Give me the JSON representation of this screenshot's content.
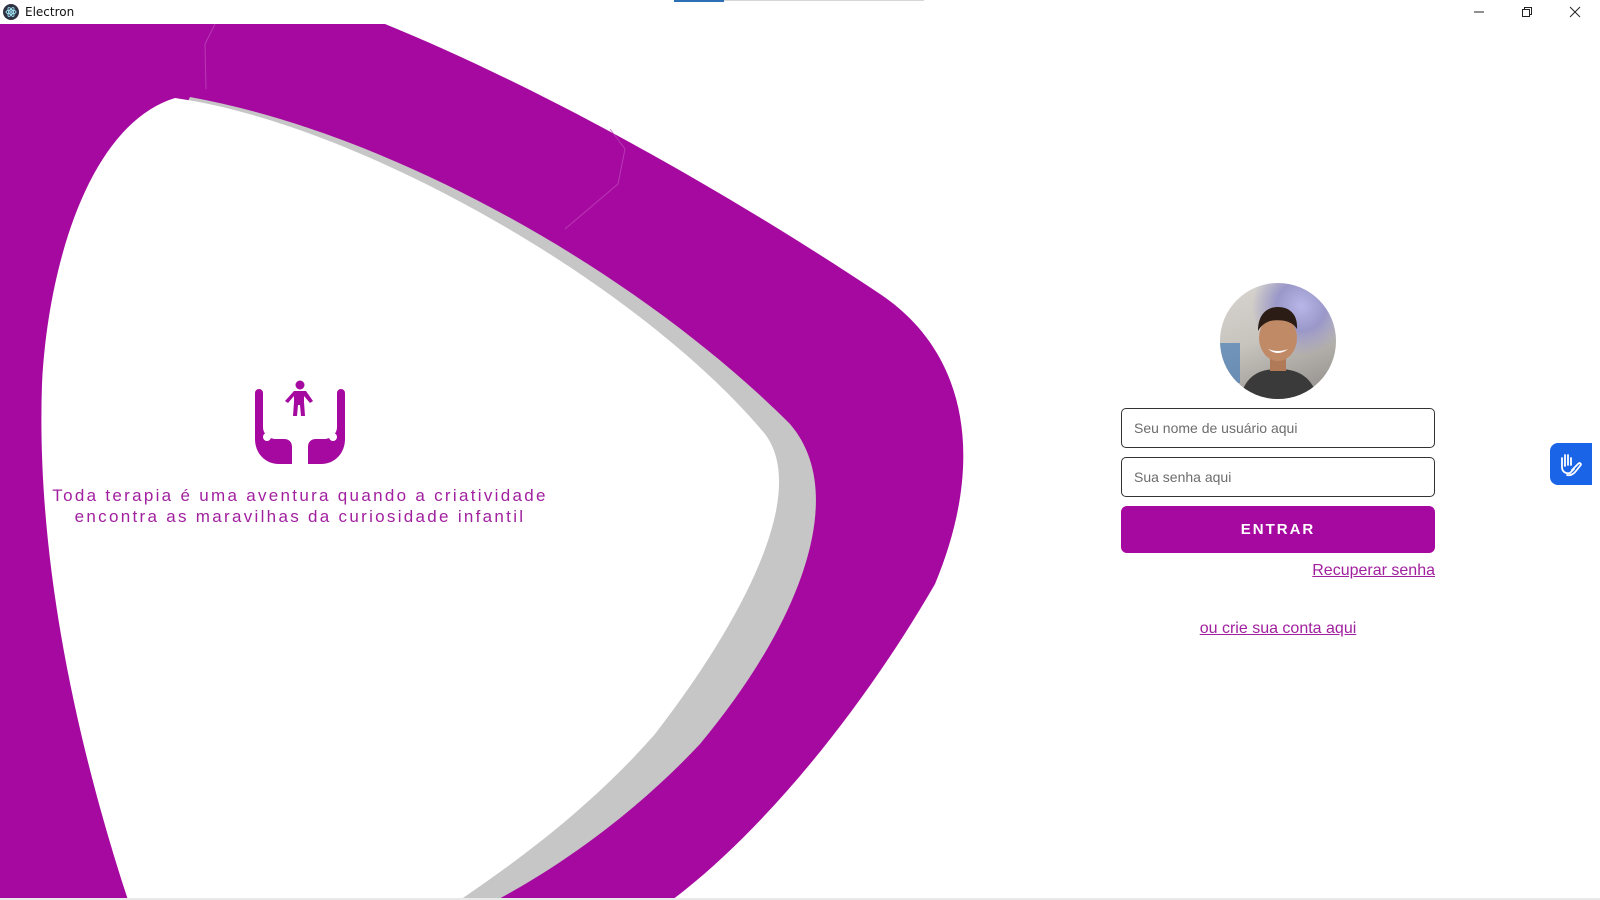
{
  "window": {
    "title": "Electron",
    "icon": "electron-icon",
    "controls": [
      "minimize-icon",
      "restore-icon",
      "close-icon"
    ]
  },
  "brand": {
    "icon": "hands-holding-child-icon",
    "tagline_line1": "Toda terapia é uma aventura quando a criatividade",
    "tagline_line2": "encontra as maravilhas da curiosidade infantil"
  },
  "login": {
    "username_placeholder": "Seu nome de usuário aqui",
    "password_placeholder": "Sua senha aqui",
    "submit_label": "ENTRAR",
    "recover_label": "Recuperar senha",
    "create_account_label": "ou crie sua conta aqui"
  },
  "accessibility": {
    "icon": "sign-language-hands-icon"
  },
  "colors": {
    "brand": "#a6099f",
    "accent_text": "#a1209f",
    "arc_gray": "#c6c6c6",
    "libras_blue": "#1a64e8"
  }
}
